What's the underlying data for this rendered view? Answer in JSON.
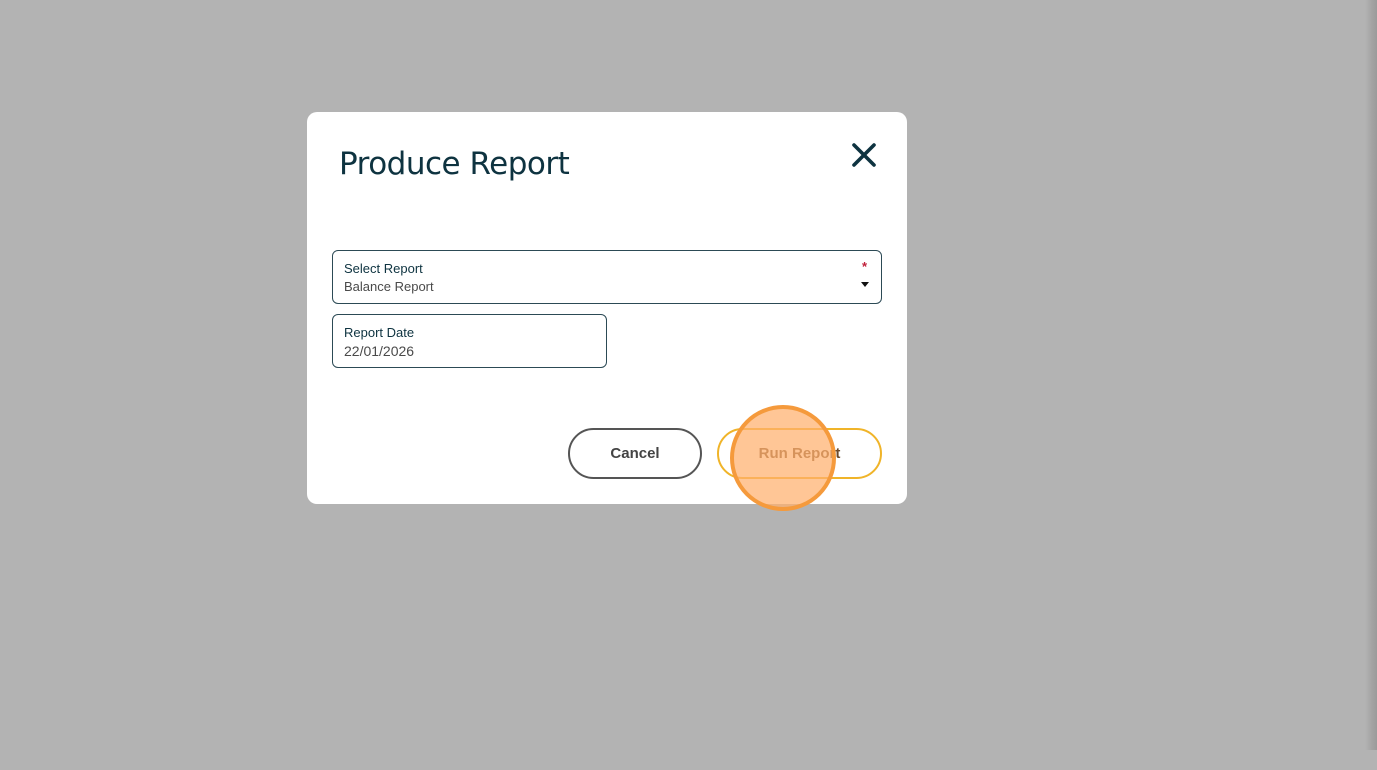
{
  "dialog": {
    "title": "Produce Report",
    "close_icon": "close-icon"
  },
  "fields": {
    "select_report": {
      "label": "Select Report",
      "value": "Balance Report",
      "required_mark": "*"
    },
    "report_date": {
      "label": "Report Date",
      "value": "22/01/2026"
    }
  },
  "actions": {
    "cancel_label": "Cancel",
    "run_label": "Run Report"
  },
  "colors": {
    "overlay": "#b3b3b3",
    "title_text": "#0e3340",
    "field_border": "#2c4a55",
    "required": "#c0203a",
    "run_border": "#f0b429",
    "click_indicator": "#f59a3c"
  }
}
